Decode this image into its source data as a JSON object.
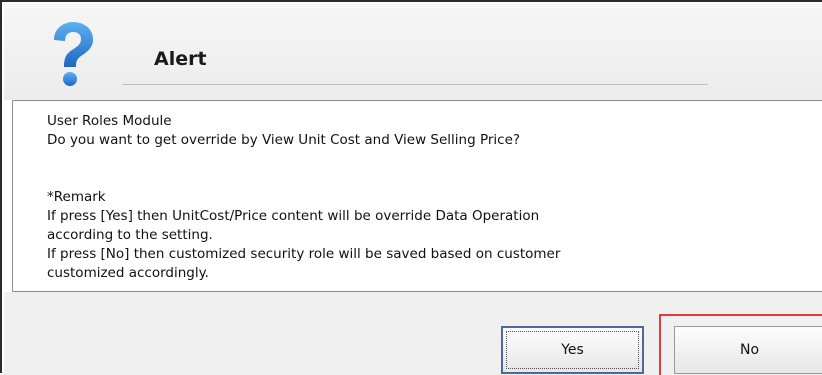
{
  "dialog": {
    "title": "Alert",
    "icon": "question-icon",
    "message_lines": [
      "User Roles Module",
      "Do you want to get override by View Unit Cost and View Selling Price?",
      "",
      "",
      "*Remark",
      "If press [Yes] then UnitCost/Price content will be override Data Operation",
      "according to the setting.",
      "If press [No] then customized security role will be saved based on customer",
      "customized accordingly."
    ],
    "buttons": {
      "yes_label": "Yes",
      "no_label": "No"
    }
  },
  "colors": {
    "icon_blue": "#2f7fd6",
    "focus_red": "#e03c3c",
    "default_border": "#4a6a9a"
  }
}
